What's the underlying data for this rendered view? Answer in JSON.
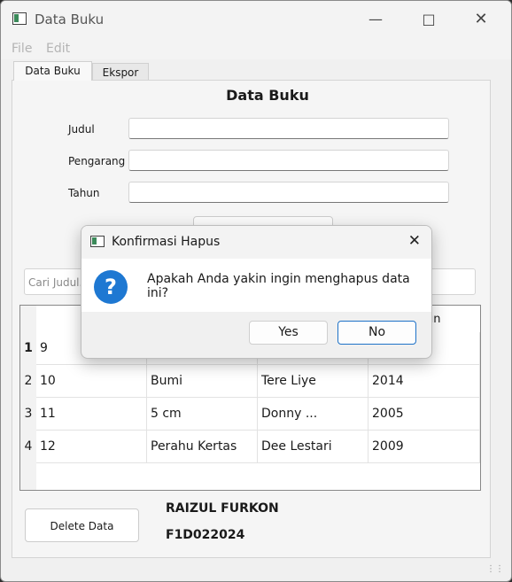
{
  "window": {
    "title": "Data Buku",
    "icon": "app-window-icon"
  },
  "menu": [
    "File",
    "Edit"
  ],
  "tabs": [
    {
      "label": "Data Buku",
      "active": true
    },
    {
      "label": "Ekspor",
      "active": false
    }
  ],
  "form": {
    "title": "Data Buku",
    "fields": [
      {
        "label": "Judul",
        "value": ""
      },
      {
        "label": "Pengarang",
        "value": ""
      },
      {
        "label": "Tahun",
        "value": ""
      }
    ]
  },
  "search": {
    "placeholder": "Cari Judul..."
  },
  "table": {
    "last_header_fragment": "un",
    "row_numbers": [
      "1",
      "2",
      "3",
      "4"
    ],
    "rows": [
      [
        "9",
        "",
        "",
        ""
      ],
      [
        "10",
        "Bumi",
        "Tere Liye",
        "2014"
      ],
      [
        "11",
        "5 cm",
        "Donny ...",
        "2005"
      ],
      [
        "12",
        "Perahu Kertas",
        "Dee Lestari",
        "2009"
      ]
    ]
  },
  "delete_button": "Delete Data",
  "credits": {
    "name": "RAIZUL FURKON",
    "id": "F1D022024"
  },
  "dialog": {
    "title": "Konfirmasi Hapus",
    "message": "Apakah Anda yakin ingin menghapus data ini?",
    "icon": "question-icon",
    "yes": "Yes",
    "no": "No",
    "accent": "#1e78d2"
  }
}
